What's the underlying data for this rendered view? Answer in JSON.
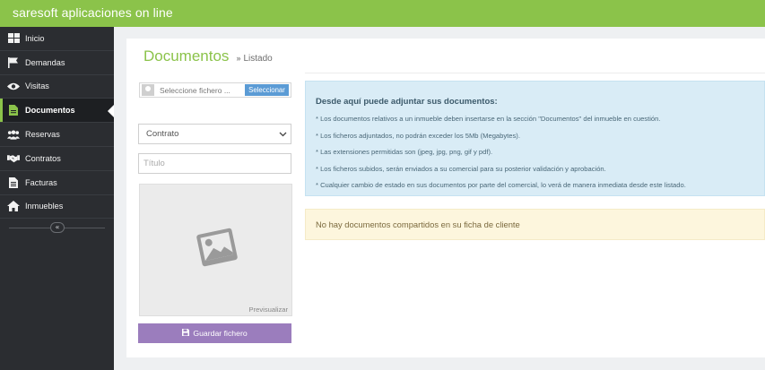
{
  "app": {
    "title": "saresoft aplicaciones on line"
  },
  "sidebar": {
    "items": [
      {
        "label": "Inicio",
        "icon": "dashboard-icon"
      },
      {
        "label": "Demandas",
        "icon": "flag-icon"
      },
      {
        "label": "Visitas",
        "icon": "eye-icon"
      },
      {
        "label": "Documentos",
        "icon": "document-icon",
        "active": true
      },
      {
        "label": "Reservas",
        "icon": "group-icon"
      },
      {
        "label": "Contratos",
        "icon": "handshake-icon"
      },
      {
        "label": "Facturas",
        "icon": "invoice-icon"
      },
      {
        "label": "Inmuebles",
        "icon": "home-icon"
      }
    ],
    "collapse_glyph": "«"
  },
  "page": {
    "title": "Documentos",
    "breadcrumb_sep": "»",
    "breadcrumb": "Listado"
  },
  "form": {
    "file_placeholder": "Seleccione fichero ...",
    "file_button": "Seleccionar",
    "select_value": "Contrato",
    "title_placeholder": "Título",
    "preview_label": "Previsualizar",
    "save_button": "Guardar fichero"
  },
  "info": {
    "title": "Desde aquí puede adjuntar sus documentos:",
    "items": [
      "* Los documentos relativos a un inmueble deben insertarse en la sección \"Documentos\" del inmueble en cuestión.",
      "* Los ficheros adjuntados, no podrán exceder los 5Mb (Megabytes).",
      "* Las extensiones permitidas son (jpeg, jpg, png, gif y pdf).",
      "* Los ficheros subidos, serán enviados a su comercial para su posterior validación y aprobación.",
      "* Cualquier cambio de estado en sus documentos por parte del comercial, lo verá de manera inmediata desde este listado."
    ]
  },
  "notice": {
    "text": "No hay documentos compartidos en su ficha de cliente"
  },
  "colors": {
    "brand": "#8bc34a",
    "sidebar_bg": "#2b2d31",
    "file_button": "#5b9bd5",
    "save_button": "#9b7dbd",
    "info_bg": "#d9ecf6",
    "notice_bg": "#fdf6dd"
  }
}
